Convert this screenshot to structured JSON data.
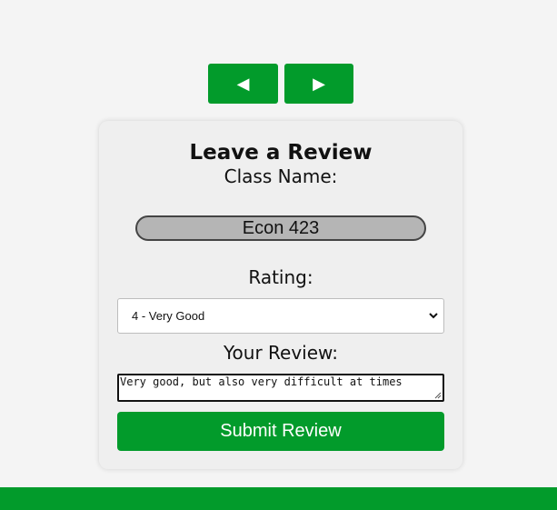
{
  "nav": {
    "prev_icon": "◀",
    "next_icon": "▶"
  },
  "review_form": {
    "title": "Leave a Review",
    "class_name_label": "Class Name:",
    "class_name_value": "Econ 423",
    "rating_label": "Rating:",
    "rating_selected": "4 - Very Good",
    "review_label": "Your Review:",
    "review_value": "Very good, but also very difficult at times",
    "submit_label": "Submit Review"
  },
  "colors": {
    "accent": "#029b2b",
    "page_background": "#f4f4f4",
    "card_background": "#efefef",
    "class_field_background": "#b5b5b5"
  }
}
